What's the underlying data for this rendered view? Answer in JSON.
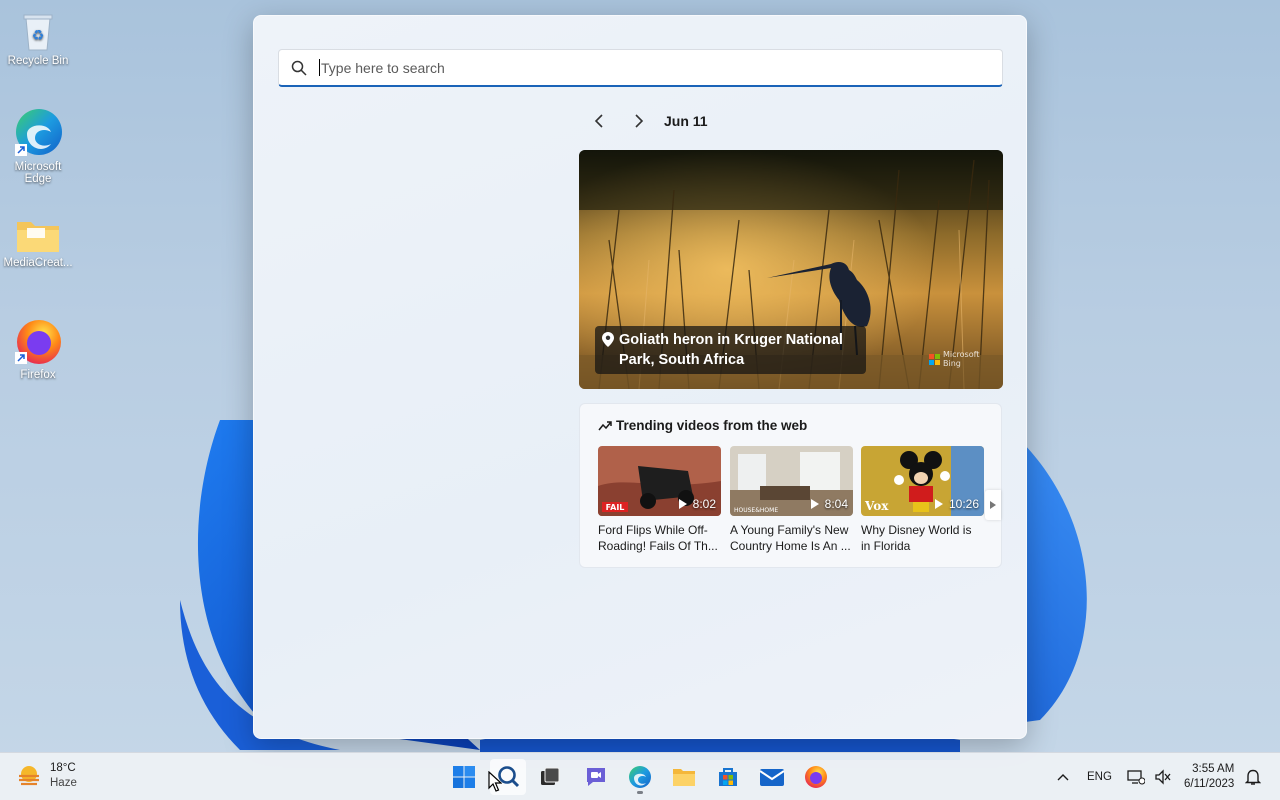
{
  "desktop": {
    "icons": [
      {
        "label": "Recycle Bin"
      },
      {
        "label": "Microsoft Edge"
      },
      {
        "label": "MediaCreat..."
      },
      {
        "label": "Firefox"
      }
    ]
  },
  "search": {
    "placeholder": "Type here to search",
    "date": "Jun 11",
    "hero_caption": "Goliath heron in Kruger National Park, South Africa",
    "hero_watermark": "Microsoft Bing",
    "trending_title": "Trending videos from the web",
    "videos": [
      {
        "title": "Ford Flips While Off-Roading! Fails Of Th...",
        "duration": "8:02"
      },
      {
        "title": "A Young Family's New Country Home Is An ...",
        "duration": "8:04"
      },
      {
        "title": "Why Disney World is in Florida",
        "duration": "10:26"
      }
    ]
  },
  "taskbar": {
    "weather_temp": "18°C",
    "weather_desc": "Haze",
    "language": "ENG",
    "time": "3:55 AM",
    "date": "6/11/2023"
  }
}
